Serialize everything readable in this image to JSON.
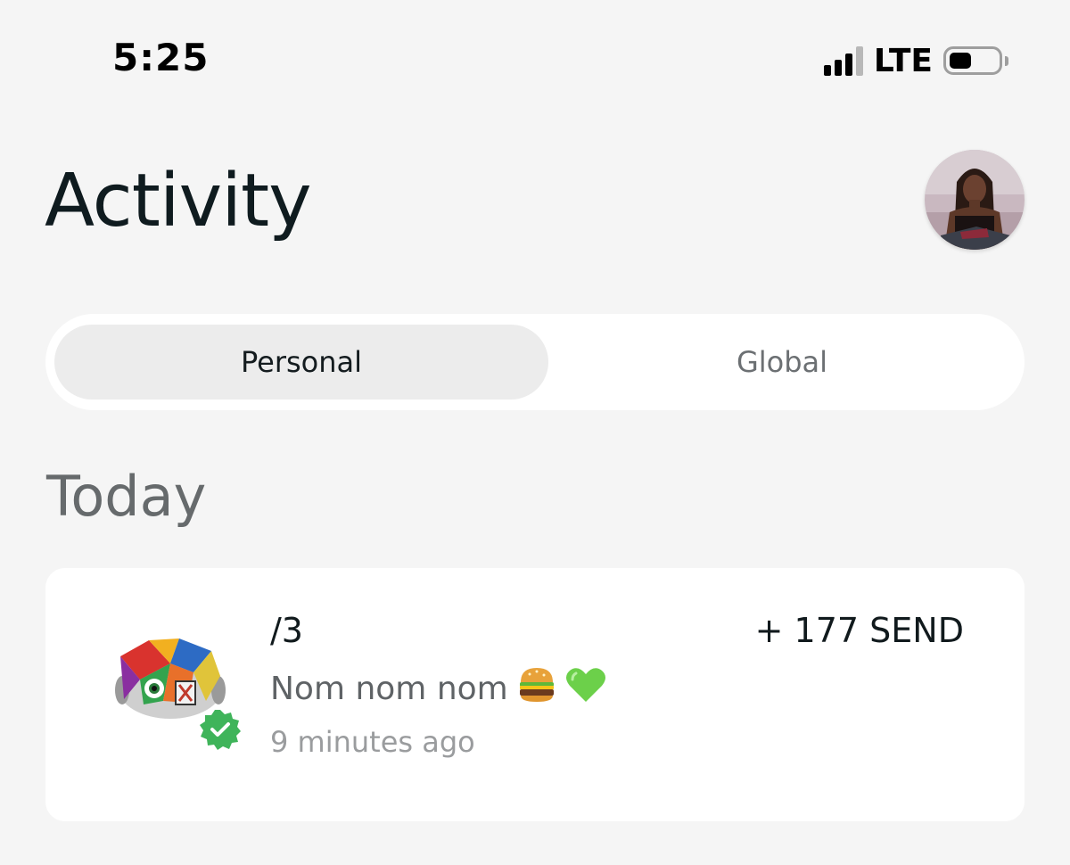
{
  "status_bar": {
    "time": "5:25",
    "network": "LTE",
    "icons": [
      "signal-icon",
      "battery-icon"
    ]
  },
  "header": {
    "title": "Activity",
    "avatar_icon": "profile-avatar"
  },
  "tabs": [
    {
      "label": "Personal",
      "selected": true
    },
    {
      "label": "Global",
      "selected": false
    }
  ],
  "section": {
    "heading": "Today"
  },
  "activity": [
    {
      "title": "/3",
      "message": "Nom nom nom",
      "message_emojis": [
        "burger-emoji",
        "green-heart-emoji"
      ],
      "time": "9 minutes ago",
      "amount": "+ 177 SEND",
      "verified": true
    }
  ],
  "colors": {
    "background": "#f5f5f5",
    "card": "#ffffff",
    "selected_tab": "#ececec",
    "verified_badge": "#3fb45a",
    "title_text": "#0f1b1f"
  }
}
